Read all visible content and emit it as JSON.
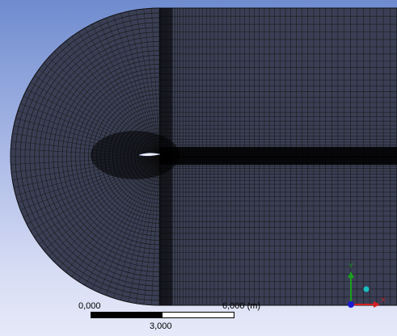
{
  "viewer": {
    "background_top": "#6f8ccf",
    "background_bottom": "#e6e9f8",
    "mesh_line_color": "#1a1a1a",
    "mesh_fill_color": "#3a3f55"
  },
  "scale": {
    "left_label": "0,000",
    "right_label": "6,000 (m)",
    "middle_label": "3,000"
  },
  "triad": {
    "y_axis_label": "Y",
    "x_axis_label": "X",
    "y_color": "#1aa01a",
    "x_color": "#d42020",
    "z_color": "#1a1ad4",
    "iso_color": "#19c0c0"
  }
}
